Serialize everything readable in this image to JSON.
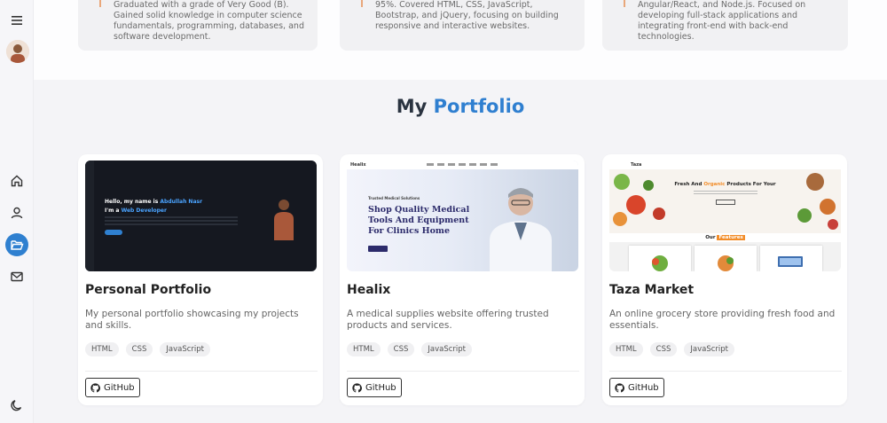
{
  "sidebar": {
    "menu_icon": "hamburger-menu-icon",
    "items": [
      {
        "icon": "home-icon",
        "active": false
      },
      {
        "icon": "user-icon",
        "active": false
      },
      {
        "icon": "folder-open-icon",
        "active": true
      },
      {
        "icon": "mail-icon",
        "active": false
      }
    ],
    "theme_icon": "moon-icon",
    "accent_color": "#2f80d0"
  },
  "education": [
    {
      "text": "Graduated with a grade of Very Good (B). Gained solid knowledge in computer science fundamentals, programming, databases, and software development."
    },
    {
      "text": "95%. Covered HTML, CSS, JavaScript, Bootstrap, and jQuery, focusing on building responsive and interactive websites."
    },
    {
      "text": "Angular/React, and Node.js. Focused on developing full-stack applications and integrating front-end with back-end technologies."
    }
  ],
  "portfolio": {
    "title_prefix": "My",
    "title_accent": "Portfolio",
    "accent_color": "#2f7fd0",
    "projects": [
      {
        "title": "Personal Portfolio",
        "description": "My personal portfolio showcasing my projects and skills.",
        "tags": [
          "HTML",
          "CSS",
          "JavaScript"
        ],
        "github_label": "GitHub",
        "thumb": {
          "hello": "Hello, my name is",
          "name": "Abdullah Nasr",
          "im_a": "I'm a",
          "role": "Web Developer"
        }
      },
      {
        "title": "Healix",
        "description": "A medical supplies website offering trusted products and services.",
        "tags": [
          "HTML",
          "CSS",
          "JavaScript"
        ],
        "github_label": "GitHub",
        "thumb": {
          "logo": "Healix",
          "subtitle": "Trusted Medical Solutions",
          "headline": "Shop Quality Medical Tools And Equipment For Clinics Home"
        }
      },
      {
        "title": "Taza Market",
        "description": "An online grocery store providing fresh food and essentials.",
        "tags": [
          "HTML",
          "CSS",
          "JavaScript"
        ],
        "github_label": "GitHub",
        "thumb": {
          "logo": "Taza",
          "hero_prefix": "Fresh And",
          "hero_accent": "Organic",
          "hero_suffix": "Products For Your",
          "features_prefix": "Our",
          "features_accent": "Features"
        }
      }
    ]
  }
}
